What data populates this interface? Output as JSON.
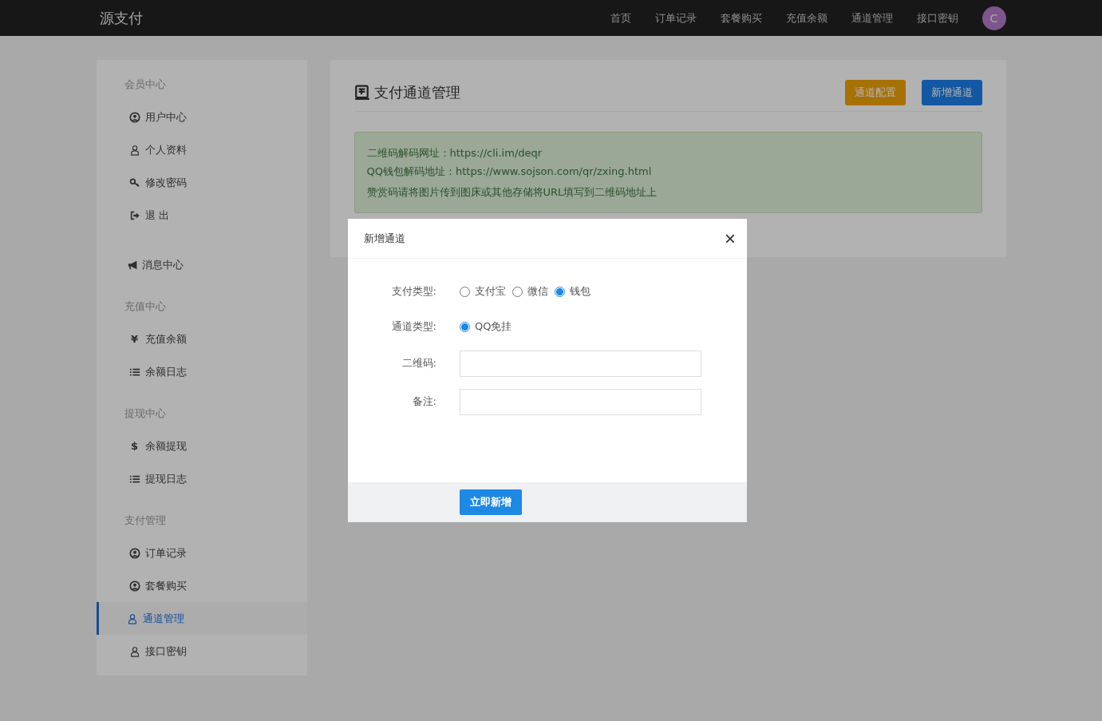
{
  "topbar": {
    "brand": "源支付",
    "nav": [
      {
        "label": "首页"
      },
      {
        "label": "订单记录"
      },
      {
        "label": "套餐购买"
      },
      {
        "label": "充值余额"
      },
      {
        "label": "通道管理"
      },
      {
        "label": "接口密钥"
      }
    ],
    "avatar": "C"
  },
  "sidebar": {
    "items": [
      {
        "kind": "header",
        "label": "会员中心"
      },
      {
        "kind": "user-circle",
        "label": "用户中心",
        "selected": false
      },
      {
        "kind": "user",
        "label": "个人资料",
        "selected": false
      },
      {
        "kind": "key",
        "label": "修改密码",
        "selected": false
      },
      {
        "kind": "logout",
        "label": "退 出",
        "selected": false
      },
      {
        "kind": "bullhorn",
        "label": "消息中心",
        "selected": false
      },
      {
        "kind": "header",
        "label": "充值中心"
      },
      {
        "kind": "glyph",
        "glyph": "¥",
        "label": "充值余额",
        "selected": false
      },
      {
        "kind": "list",
        "label": "余额日志",
        "selected": false
      },
      {
        "kind": "header",
        "label": "提现中心"
      },
      {
        "kind": "glyph",
        "glyph": "$",
        "label": "余额提现",
        "selected": false
      },
      {
        "kind": "list",
        "label": "提现日志",
        "selected": false
      },
      {
        "kind": "header",
        "label": "支付管理"
      },
      {
        "kind": "user-circle",
        "label": "订单记录",
        "selected": false
      },
      {
        "kind": "user-circle",
        "label": "套餐购买",
        "selected": false
      },
      {
        "kind": "user",
        "label": "通道管理",
        "selected": true
      },
      {
        "kind": "user",
        "label": "接口密钥",
        "selected": false
      }
    ]
  },
  "panel": {
    "title": "支付通道管理",
    "buttons": [
      {
        "label": "通道配置",
        "kind": "warning"
      },
      {
        "label": "新增通道",
        "kind": "primary"
      }
    ],
    "notice": [
      "二维码解码网址：https://cli.im/deqr",
      "QQ钱包解码地址：https://www.sojson.com/qr/zxing.html",
      "赞赏码请将图片传到图床或其他存储将URL填写到二维码地址上"
    ]
  },
  "dialog": {
    "title": "新增通道",
    "close": "×",
    "fields": [
      {
        "kind": "radio",
        "label": "支付类型:",
        "options": [
          {
            "label": "支付宝",
            "selected": false
          },
          {
            "label": "微信",
            "selected": false
          },
          {
            "label": "钱包",
            "selected": true
          }
        ]
      },
      {
        "kind": "radio",
        "label": "通道类型:",
        "options": [
          {
            "label": "QQ免挂",
            "selected": true
          }
        ]
      },
      {
        "kind": "input",
        "label": "二维码:"
      },
      {
        "kind": "input",
        "label": "备注:"
      }
    ],
    "submit": "立即新增"
  }
}
